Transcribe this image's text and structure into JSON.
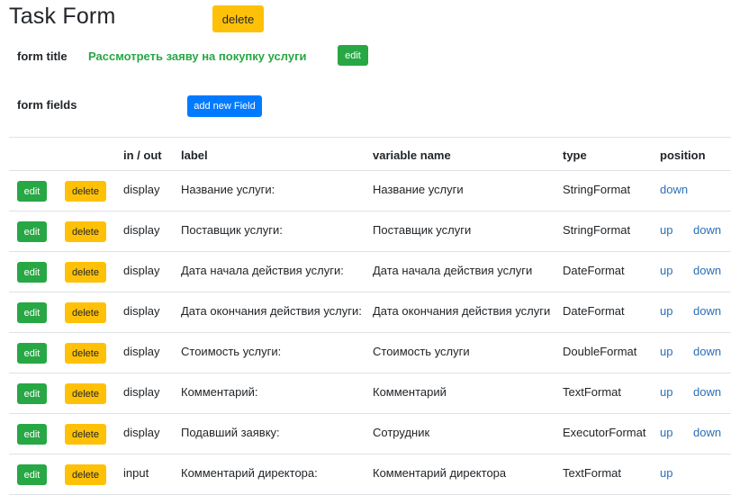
{
  "page": {
    "title": "Task Form",
    "delete_label": "delete",
    "form_title_label": "form title",
    "form_title_value": "Рассмотреть заяву на покупку услуги",
    "edit_label": "edit",
    "form_fields_label": "form fields",
    "add_field_label": "add new Field"
  },
  "table": {
    "headers": [
      "",
      "",
      "in / out",
      "label",
      "variable name",
      "type",
      "position"
    ],
    "rows": [
      {
        "edit": "edit",
        "delete": "delete",
        "io": "display",
        "label": "Название услуги:",
        "variable": "Название услуги",
        "type": "StringFormat",
        "up": "",
        "down": "down"
      },
      {
        "edit": "edit",
        "delete": "delete",
        "io": "display",
        "label": "Поставщик услуги:",
        "variable": "Поставщик услуги",
        "type": "StringFormat",
        "up": "up",
        "down": "down"
      },
      {
        "edit": "edit",
        "delete": "delete",
        "io": "display",
        "label": "Дата начала действия услуги:",
        "variable": "Дата начала действия услуги",
        "type": "DateFormat",
        "up": "up",
        "down": "down"
      },
      {
        "edit": "edit",
        "delete": "delete",
        "io": "display",
        "label": "Дата окончания действия услуги:",
        "variable": "Дата окончания действия услуги",
        "type": "DateFormat",
        "up": "up",
        "down": "down"
      },
      {
        "edit": "edit",
        "delete": "delete",
        "io": "display",
        "label": "Стоимость услуги:",
        "variable": "Стоимость услуги",
        "type": "DoubleFormat",
        "up": "up",
        "down": "down"
      },
      {
        "edit": "edit",
        "delete": "delete",
        "io": "display",
        "label": "Комментарий:",
        "variable": "Комментарий",
        "type": "TextFormat",
        "up": "up",
        "down": "down"
      },
      {
        "edit": "edit",
        "delete": "delete",
        "io": "display",
        "label": "Подавший заявку:",
        "variable": "Сотрудник",
        "type": "ExecutorFormat",
        "up": "up",
        "down": "down"
      },
      {
        "edit": "edit",
        "delete": "delete",
        "io": "input",
        "label": "Комментарий директора:",
        "variable": "Комментарий директора",
        "type": "TextFormat",
        "up": "up",
        "down": ""
      }
    ]
  }
}
